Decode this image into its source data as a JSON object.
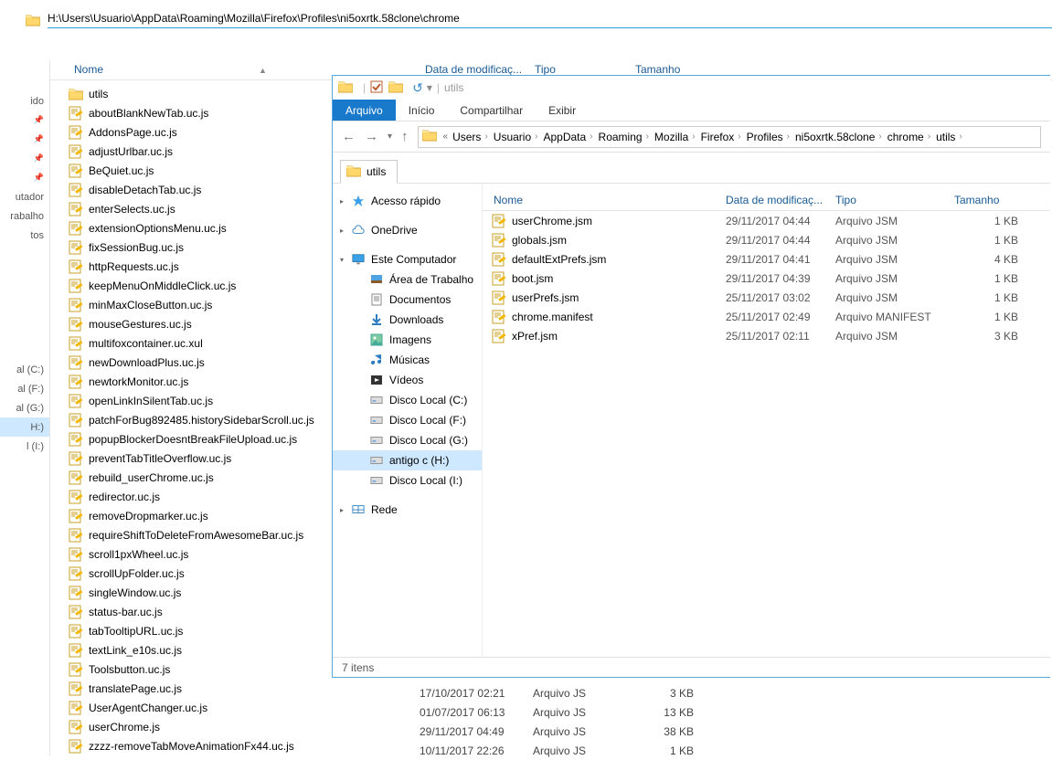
{
  "outer": {
    "address": "H:\\Users\\Usuario\\AppData\\Roaming\\Mozilla\\Firefox\\Profiles\\ni5oxrtk.58clone\\chrome",
    "left_items": [
      "ido",
      "",
      "",
      "",
      "",
      "utador",
      "rabalho",
      "tos",
      "",
      "",
      "",
      "",
      "",
      "",
      "al (C:)",
      "al (F:)",
      "al (G:)",
      "H:)",
      "l (I:)"
    ],
    "left_pins": [
      1,
      2,
      3,
      4
    ],
    "left_selected_index": 17,
    "columns": {
      "name": "Nome",
      "date": "Data de modificaç...",
      "type": "Tipo",
      "size": "Tamanho"
    },
    "files": [
      {
        "name": "utils",
        "kind": "folder"
      },
      {
        "name": "aboutBlankNewTab.uc.js",
        "kind": "script"
      },
      {
        "name": "AddonsPage.uc.js",
        "kind": "script"
      },
      {
        "name": "adjustUrlbar.uc.js",
        "kind": "script"
      },
      {
        "name": "BeQuiet.uc.js",
        "kind": "script"
      },
      {
        "name": "disableDetachTab.uc.js",
        "kind": "script"
      },
      {
        "name": "enterSelects.uc.js",
        "kind": "script"
      },
      {
        "name": "extensionOptionsMenu.uc.js",
        "kind": "script"
      },
      {
        "name": "fixSessionBug.uc.js",
        "kind": "script"
      },
      {
        "name": "httpRequests.uc.js",
        "kind": "script"
      },
      {
        "name": "keepMenuOnMiddleClick.uc.js",
        "kind": "script"
      },
      {
        "name": "minMaxCloseButton.uc.js",
        "kind": "script"
      },
      {
        "name": "mouseGestures.uc.js",
        "kind": "script"
      },
      {
        "name": "multifoxcontainer.uc.xul",
        "kind": "script"
      },
      {
        "name": "newDownloadPlus.uc.js",
        "kind": "script"
      },
      {
        "name": "newtorkMonitor.uc.js",
        "kind": "script"
      },
      {
        "name": "openLinkInSilentTab.uc.js",
        "kind": "script"
      },
      {
        "name": "patchForBug892485.historySidebarScroll.uc.js",
        "kind": "script"
      },
      {
        "name": "popupBlockerDoesntBreakFileUpload.uc.js",
        "kind": "script"
      },
      {
        "name": "preventTabTitleOverflow.uc.js",
        "kind": "script"
      },
      {
        "name": "rebuild_userChrome.uc.js",
        "kind": "script"
      },
      {
        "name": "redirector.uc.js",
        "kind": "script"
      },
      {
        "name": "removeDropmarker.uc.js",
        "kind": "script"
      },
      {
        "name": "requireShiftToDeleteFromAwesomeBar.uc.js",
        "kind": "script"
      },
      {
        "name": "scroll1pxWheel.uc.js",
        "kind": "script"
      },
      {
        "name": "scrollUpFolder.uc.js",
        "kind": "script"
      },
      {
        "name": "singleWindow.uc.js",
        "kind": "script"
      },
      {
        "name": "status-bar.uc.js",
        "kind": "script"
      },
      {
        "name": "tabTooltipURL.uc.js",
        "kind": "script"
      },
      {
        "name": "textLink_e10s.uc.js",
        "kind": "script"
      },
      {
        "name": "Toolsbutton.uc.js",
        "kind": "script"
      },
      {
        "name": "translatePage.uc.js",
        "kind": "script"
      },
      {
        "name": "UserAgentChanger.uc.js",
        "kind": "script"
      },
      {
        "name": "userChrome.js",
        "kind": "script"
      },
      {
        "name": "zzzz-removeTabMoveAnimationFx44.uc.js",
        "kind": "script"
      }
    ],
    "bottom_rows": [
      {
        "date": "17/10/2017 02:21",
        "type": "Arquivo JS",
        "size": "3 KB"
      },
      {
        "date": "01/07/2017 06:13",
        "type": "Arquivo JS",
        "size": "13 KB"
      },
      {
        "date": "29/11/2017 04:49",
        "type": "Arquivo JS",
        "size": "38 KB"
      },
      {
        "date": "10/11/2017 22:26",
        "type": "Arquivo JS",
        "size": "1 KB"
      }
    ]
  },
  "inner": {
    "title_text": "utils",
    "ribbon": {
      "active": "Arquivo",
      "tabs": [
        "Início",
        "Compartilhar",
        "Exibir"
      ]
    },
    "crumbs": [
      "Users",
      "Usuario",
      "AppData",
      "Roaming",
      "Mozilla",
      "Firefox",
      "Profiles",
      "ni5oxrtk.58clone",
      "chrome",
      "utils"
    ],
    "foldertab": "utils",
    "nav": {
      "quick": "Acesso rápido",
      "onedrive": "OneDrive",
      "thispc": "Este Computador",
      "children": [
        "Área de Trabalho",
        "Documentos",
        "Downloads",
        "Imagens",
        "Músicas",
        "Vídeos"
      ],
      "drives": [
        "Disco Local (C:)",
        "Disco Local (F:)",
        "Disco Local (G:)",
        "antigo c (H:)",
        "Disco Local (I:)"
      ],
      "drive_selected_index": 3,
      "network": "Rede"
    },
    "columns": {
      "name": "Nome",
      "date": "Data de modificaç...",
      "type": "Tipo",
      "size": "Tamanho"
    },
    "files": [
      {
        "name": "userChrome.jsm",
        "date": "29/11/2017 04:44",
        "type": "Arquivo JSM",
        "size": "1 KB"
      },
      {
        "name": "globals.jsm",
        "date": "29/11/2017 04:44",
        "type": "Arquivo JSM",
        "size": "1 KB"
      },
      {
        "name": "defaultExtPrefs.jsm",
        "date": "29/11/2017 04:41",
        "type": "Arquivo JSM",
        "size": "4 KB"
      },
      {
        "name": "boot.jsm",
        "date": "29/11/2017 04:39",
        "type": "Arquivo JSM",
        "size": "1 KB"
      },
      {
        "name": "userPrefs.jsm",
        "date": "25/11/2017 03:02",
        "type": "Arquivo JSM",
        "size": "1 KB"
      },
      {
        "name": "chrome.manifest",
        "date": "25/11/2017 02:49",
        "type": "Arquivo MANIFEST",
        "size": "1 KB"
      },
      {
        "name": "xPref.jsm",
        "date": "25/11/2017 02:11",
        "type": "Arquivo JSM",
        "size": "3 KB"
      }
    ],
    "status": "7 itens"
  }
}
